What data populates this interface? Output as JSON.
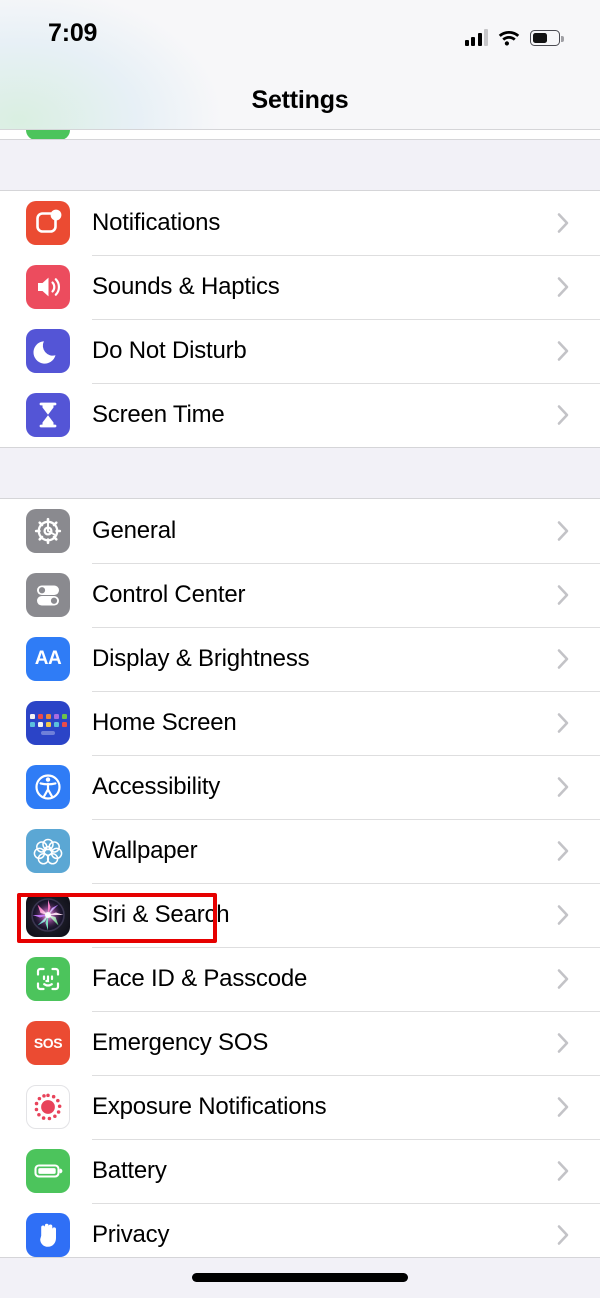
{
  "status_bar": {
    "time": "7:09",
    "signal_icon": "cellular-signal-icon",
    "signal_bars_filled": 3,
    "signal_bars_total": 4,
    "wifi_icon": "wifi-icon",
    "battery_icon": "battery-icon",
    "battery_percent": 50
  },
  "nav": {
    "title": "Settings"
  },
  "groups": [
    {
      "id": "group-notifications",
      "rows": [
        {
          "label": "Notifications",
          "icon": "notifications-icon",
          "chevron": "chevron-right-icon"
        },
        {
          "label": "Sounds & Haptics",
          "icon": "sounds-haptics-icon",
          "chevron": "chevron-right-icon"
        },
        {
          "label": "Do Not Disturb",
          "icon": "do-not-disturb-icon",
          "chevron": "chevron-right-icon"
        },
        {
          "label": "Screen Time",
          "icon": "screen-time-icon",
          "chevron": "chevron-right-icon"
        }
      ]
    },
    {
      "id": "group-system",
      "rows": [
        {
          "label": "General",
          "icon": "general-icon",
          "chevron": "chevron-right-icon"
        },
        {
          "label": "Control Center",
          "icon": "control-center-icon",
          "chevron": "chevron-right-icon"
        },
        {
          "label": "Display & Brightness",
          "icon": "display-brightness-icon",
          "chevron": "chevron-right-icon"
        },
        {
          "label": "Home Screen",
          "icon": "home-screen-icon",
          "chevron": "chevron-right-icon"
        },
        {
          "label": "Accessibility",
          "icon": "accessibility-icon",
          "chevron": "chevron-right-icon"
        },
        {
          "label": "Wallpaper",
          "icon": "wallpaper-icon",
          "chevron": "chevron-right-icon"
        },
        {
          "label": "Siri & Search",
          "icon": "siri-search-icon",
          "chevron": "chevron-right-icon",
          "highlighted": true
        },
        {
          "label": "Face ID & Passcode",
          "icon": "face-id-icon",
          "chevron": "chevron-right-icon"
        },
        {
          "label": "Emergency SOS",
          "icon": "emergency-sos-icon",
          "chevron": "chevron-right-icon"
        },
        {
          "label": "Exposure Notifications",
          "icon": "exposure-notifications-icon",
          "chevron": "chevron-right-icon"
        },
        {
          "label": "Battery",
          "icon": "battery-settings-icon",
          "chevron": "chevron-right-icon"
        },
        {
          "label": "Privacy",
          "icon": "privacy-icon",
          "chevron": "chevron-right-icon"
        }
      ]
    }
  ],
  "icon_text": {
    "display_brightness": "AA",
    "emergency_sos": "SOS"
  },
  "colors": {
    "notifications": "#eb4b32",
    "sounds_haptics": "#ec4c5e",
    "do_not_disturb": "#5455d6",
    "screen_time": "#5455d6",
    "general": "#8a8a8f",
    "control_center": "#8a8a8f",
    "display_brightness": "#2f7cf6",
    "home_screen": "#2b44c7",
    "accessibility": "#2f7cf6",
    "wallpaper": "#5ba7d4",
    "face_id": "#4cc45c",
    "emergency_sos": "#eb4b32",
    "exposure_notifications": "#ffffff",
    "exposure_dot": "#e8435a",
    "battery": "#4cc45c",
    "privacy": "#2f6ff6",
    "highlight_border": "#e60000",
    "chevron": "#c3c3c7",
    "separator": "#dededf",
    "group_background": "#ffffff",
    "page_background": "#f2f1f7",
    "header_background": "#f7f7f9"
  },
  "home_indicator": "home-indicator"
}
